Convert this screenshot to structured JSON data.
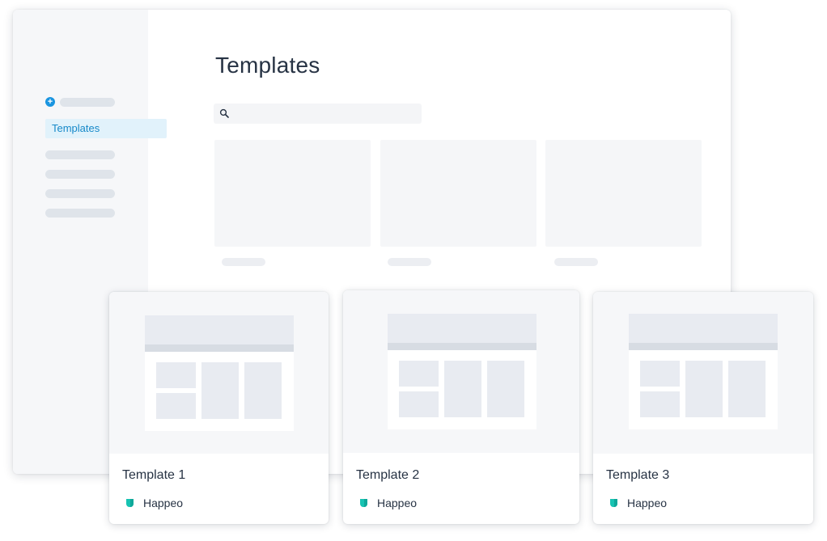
{
  "sidebar": {
    "active_item": "Templates"
  },
  "main": {
    "title": "Templates",
    "search": {
      "value": "",
      "placeholder": ""
    }
  },
  "template_cards": [
    {
      "name": "Template 1",
      "owner": "Happeo"
    },
    {
      "name": "Template 2",
      "owner": "Happeo"
    },
    {
      "name": "Template 3",
      "owner": "Happeo"
    }
  ],
  "icons": {
    "add": "plus-icon",
    "search": "search-icon",
    "owner": "happeo-logo-icon"
  },
  "colors": {
    "accent": "#1a95e0",
    "active_item_bg": "#e1f2fb",
    "active_item_text": "#1789c9",
    "brand_teal": "#17c3b2",
    "text": "#273344"
  }
}
